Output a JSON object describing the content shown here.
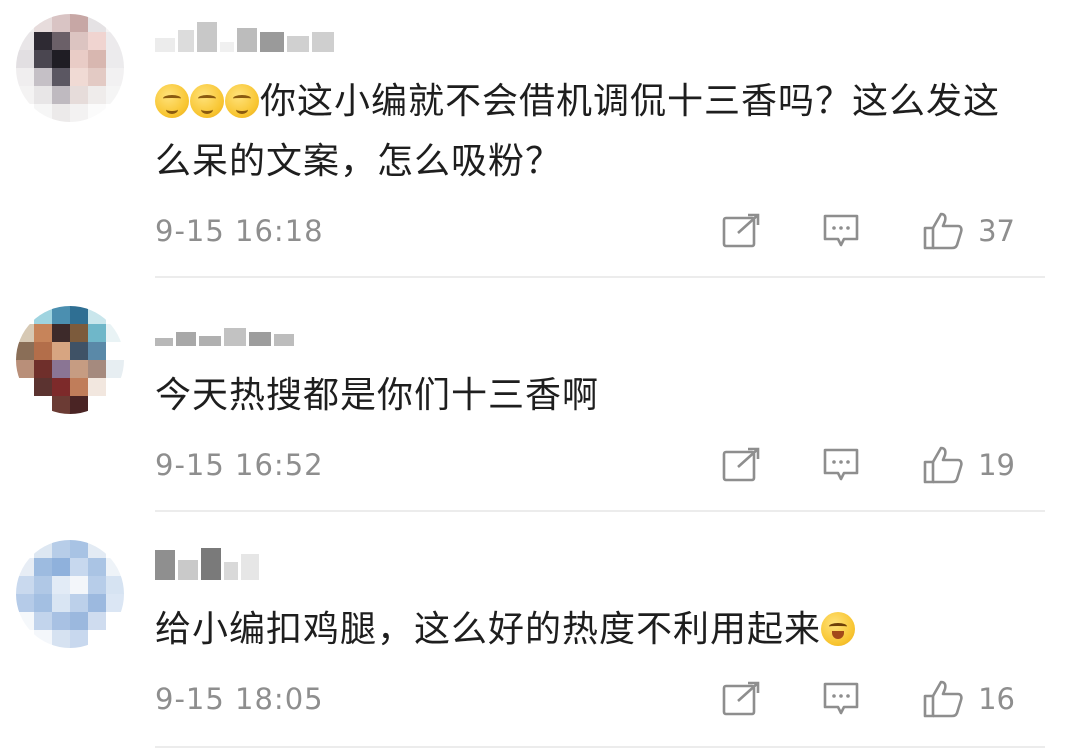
{
  "comments": [
    {
      "username": "",
      "text": "你这小编就不会借机调侃十三香吗？这么发这么呆的文案，怎么吸粉？",
      "prefix_emojis": [
        "hmm-emoji",
        "hmm-emoji",
        "hmm-emoji"
      ],
      "suffix_emojis": [],
      "time": "9-15 16:18",
      "likes": "37",
      "avatar_palette": [
        "#f2f0f0",
        "#e7dcdc",
        "#d9c4c4",
        "#c7a7a5",
        "#e5e2e4",
        "#f6f4f4",
        "#e9e6e8",
        "#2e2a33",
        "#6b6068",
        "#dcc4c1",
        "#f0d4d0",
        "#eceaec",
        "#e2dfe2",
        "#4a4650",
        "#1f1d24",
        "#e9ccc6",
        "#d8b7b0",
        "#ecebed",
        "#f0eeef",
        "#c5c0c6",
        "#5b5762",
        "#f0dad4",
        "#e3cac4",
        "#f2f1f2",
        "#f4f3f3",
        "#e8e6e7",
        "#bfbac0",
        "#e6dcda",
        "#efeceb",
        "#f5f5f5",
        "#ffffff",
        "#f6f6f6",
        "#eceaea",
        "#f3f2f2",
        "#fbfbfb",
        "#ffffff"
      ]
    },
    {
      "username": "",
      "text": "今天热搜都是你们十三香啊",
      "prefix_emojis": [],
      "suffix_emojis": [],
      "time": "9-15 16:52",
      "likes": "19",
      "avatar_palette": [
        "#ffffff",
        "#9fd4e0",
        "#4b8fb0",
        "#2f6f93",
        "#c9e6ec",
        "#ffffff",
        "#d7c9b4",
        "#c7845a",
        "#3d2a2a",
        "#7c5b3c",
        "#6fb7c9",
        "#e9f3f5",
        "#8a6e57",
        "#b36e4a",
        "#d7a581",
        "#3f5266",
        "#5a89a8",
        "#ffffff",
        "#b98f79",
        "#6f2f2b",
        "#8a7594",
        "#c69c82",
        "#a58a7e",
        "#e7eef2",
        "#ffffff",
        "#5b3330",
        "#7d2a2a",
        "#c07d5a",
        "#f2e7df",
        "#ffffff",
        "#ffffff",
        "#ffffff",
        "#6b3b34",
        "#4a2424",
        "#ffffff",
        "#ffffff"
      ]
    },
    {
      "username": "",
      "text": "给小编扣鸡腿，这么好的热度不利用起来",
      "prefix_emojis": [],
      "suffix_emojis": [
        "laugh-cry-emoji"
      ],
      "time": "9-15 18:05",
      "likes": "16",
      "avatar_palette": [
        "#ffffff",
        "#dde7f2",
        "#b7cde8",
        "#a8c3e4",
        "#e3ebf4",
        "#ffffff",
        "#e7edf5",
        "#9dbbe0",
        "#8fb1dc",
        "#c7d8ee",
        "#aac4e4",
        "#eef3f8",
        "#c9d9ee",
        "#b0c8e6",
        "#e2ebf6",
        "#f3f6fa",
        "#b7cde9",
        "#d6e3f2",
        "#b5cbe8",
        "#a3bfe2",
        "#d9e5f3",
        "#bcd0ea",
        "#9cb9df",
        "#dbe6f4",
        "#f5f8fb",
        "#c2d4ec",
        "#a8c1e3",
        "#9bb8de",
        "#cfdcef",
        "#ffffff",
        "#ffffff",
        "#f4f7fb",
        "#d6e2f1",
        "#c8d8ee",
        "#ffffff",
        "#ffffff"
      ]
    }
  ],
  "icons": {
    "share": "share-icon",
    "reply": "reply-icon",
    "like": "thumbs-up-icon"
  },
  "colors": {
    "meta": "#8e8e8e",
    "text": "#1e1e1e",
    "divider": "#ececec"
  }
}
